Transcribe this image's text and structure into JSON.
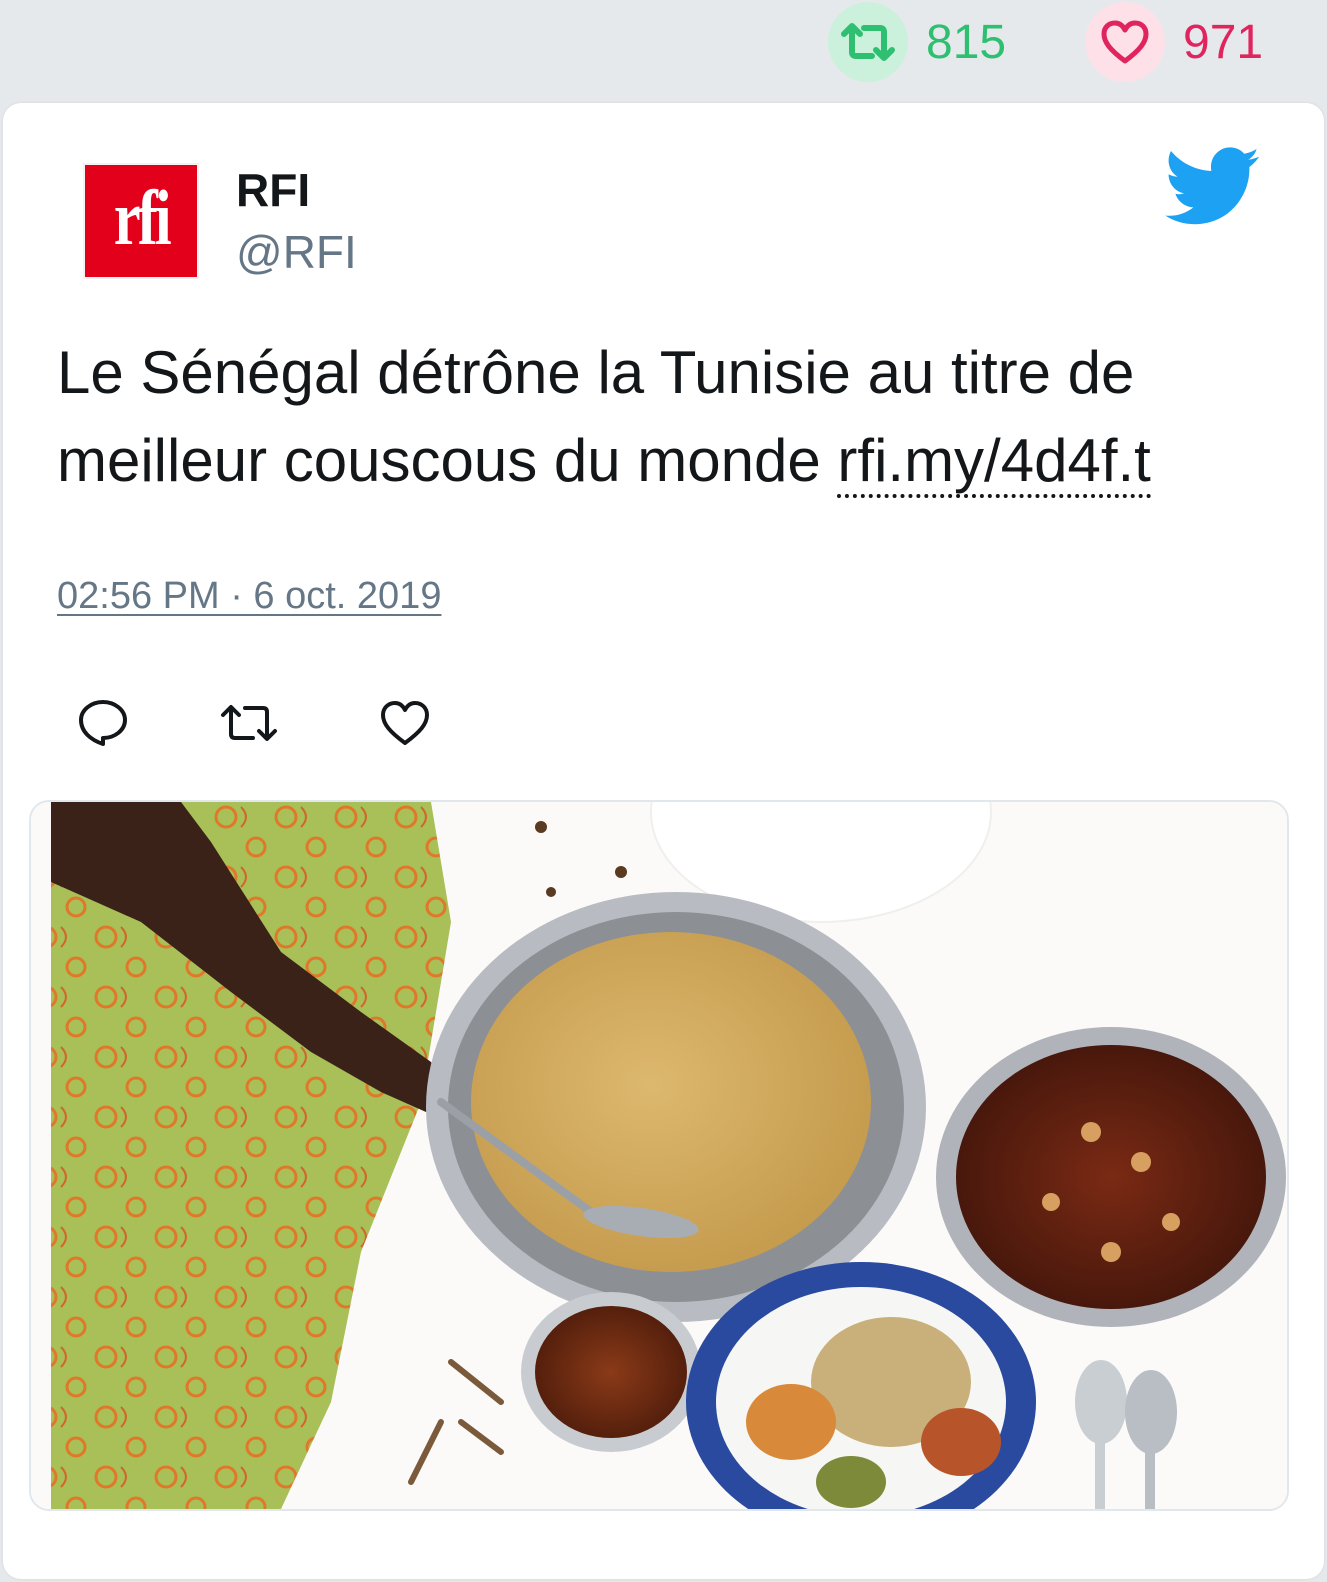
{
  "stats": {
    "retweet_icon": "retweet-icon",
    "retweets": "815",
    "like_icon": "heart-icon",
    "likes": "971"
  },
  "tweet": {
    "author_name": "RFI",
    "author_handle": "@RFI",
    "avatar_logo_text": "rfi",
    "text": "Le Sénégal détrône la Tunisie au titre de meilleur couscous du monde ",
    "link": "rfi.my/4d4f.t",
    "timestamp": "02:56 PM · 6 oct. 2019",
    "media_icon": "couscous-photo"
  },
  "actions": {
    "reply_icon": "reply-icon",
    "retweet_icon": "retweet-icon",
    "like_icon": "heart-icon"
  },
  "colors": {
    "page_bg": "#e6e9ec",
    "retweet_green": "#2fbf71",
    "like_red": "#e0245e",
    "twitter_blue": "#1da1f2",
    "rfi_red": "#e2001a",
    "text": "#14171a",
    "muted": "#657786"
  }
}
